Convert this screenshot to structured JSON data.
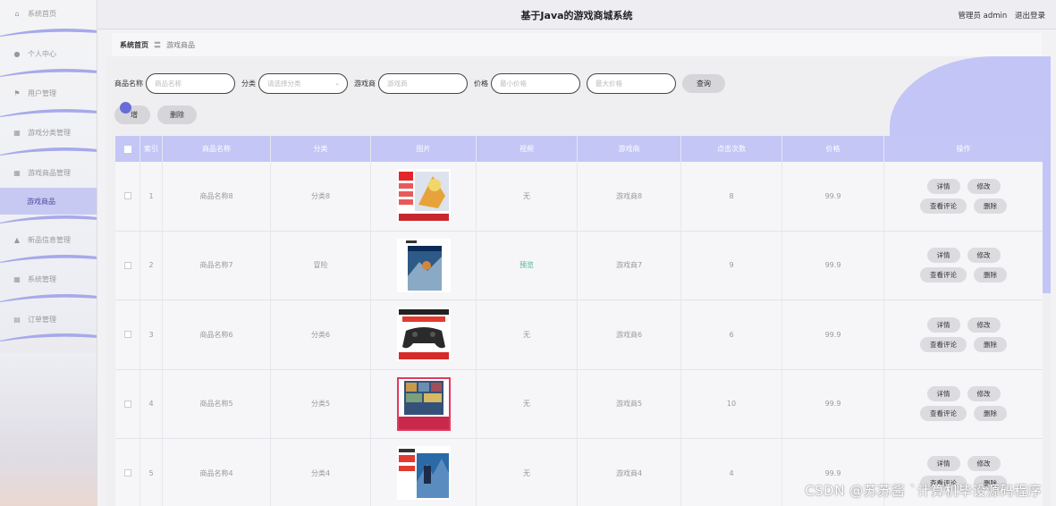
{
  "sidebar": {
    "items": [
      {
        "label": "系统首页",
        "icon": "home-icon",
        "glyph": "⌂"
      },
      {
        "label": "个人中心",
        "icon": "user-icon",
        "glyph": "●"
      },
      {
        "label": "用户管理",
        "icon": "flag-icon",
        "glyph": "⚑"
      },
      {
        "label": "游戏分类管理",
        "icon": "grid-icon",
        "glyph": "▦"
      },
      {
        "label": "游戏商品管理",
        "icon": "table-icon",
        "glyph": "▦"
      },
      {
        "label": "游戏商品",
        "icon": "",
        "glyph": ""
      },
      {
        "label": "新品信息管理",
        "icon": "bank-icon",
        "glyph": "▲"
      },
      {
        "label": "系统管理",
        "icon": "apps-icon",
        "glyph": "▦"
      },
      {
        "label": "订单管理",
        "icon": "order-icon",
        "glyph": "▤"
      }
    ]
  },
  "header": {
    "title": "基于Java的游戏商城系统",
    "user": "管理员 admin",
    "logout": "退出登录"
  },
  "breadcrumb": {
    "home": "系统首页",
    "separator": "〓",
    "current": "游戏商品"
  },
  "search": {
    "name_label": "商品名称",
    "name_placeholder": "商品名称",
    "category_label": "分类",
    "category_placeholder": "请选择分类",
    "developer_label": "游戏商",
    "developer_placeholder": "游戏商",
    "price_label": "价格",
    "min_price_placeholder": "最小价格",
    "max_price_placeholder": "最大价格",
    "query_button": "查询"
  },
  "actions": {
    "add": "新增",
    "add_visible": "增",
    "delete": "删除"
  },
  "table": {
    "columns": [
      "索引",
      "商品名称",
      "分类",
      "图片",
      "视频",
      "游戏商",
      "点击次数",
      "价格",
      "操作"
    ],
    "rows": [
      {
        "index": "1",
        "name": "商品名称8",
        "category": "分类8",
        "video": "无",
        "developer": "游戏商8",
        "clicks": "8",
        "price": "99.9",
        "image": "switch-game-cover"
      },
      {
        "index": "2",
        "name": "商品名称7",
        "category": "冒险",
        "video": "预览",
        "developer": "游戏商7",
        "clicks": "9",
        "price": "99.9",
        "image": "ps4-game-cover"
      },
      {
        "index": "3",
        "name": "商品名称6",
        "category": "分类6",
        "video": "无",
        "developer": "游戏商6",
        "clicks": "6",
        "price": "99.9",
        "image": "controller-product"
      },
      {
        "index": "4",
        "name": "商品名称5",
        "category": "分类5",
        "video": "无",
        "developer": "游戏商5",
        "clicks": "10",
        "price": "99.9",
        "image": "gta-game-cover"
      },
      {
        "index": "5",
        "name": "商品名称4",
        "category": "分类4",
        "video": "无",
        "developer": "游戏商4",
        "clicks": "4",
        "price": "99.9",
        "image": "ps4-game-cover-2"
      }
    ],
    "ops": {
      "detail": "详情",
      "edit": "修改",
      "comments": "查看评论",
      "delete": "删除"
    }
  },
  "watermark": "CSDN @苏苏酱  `计算机毕设源码程序"
}
